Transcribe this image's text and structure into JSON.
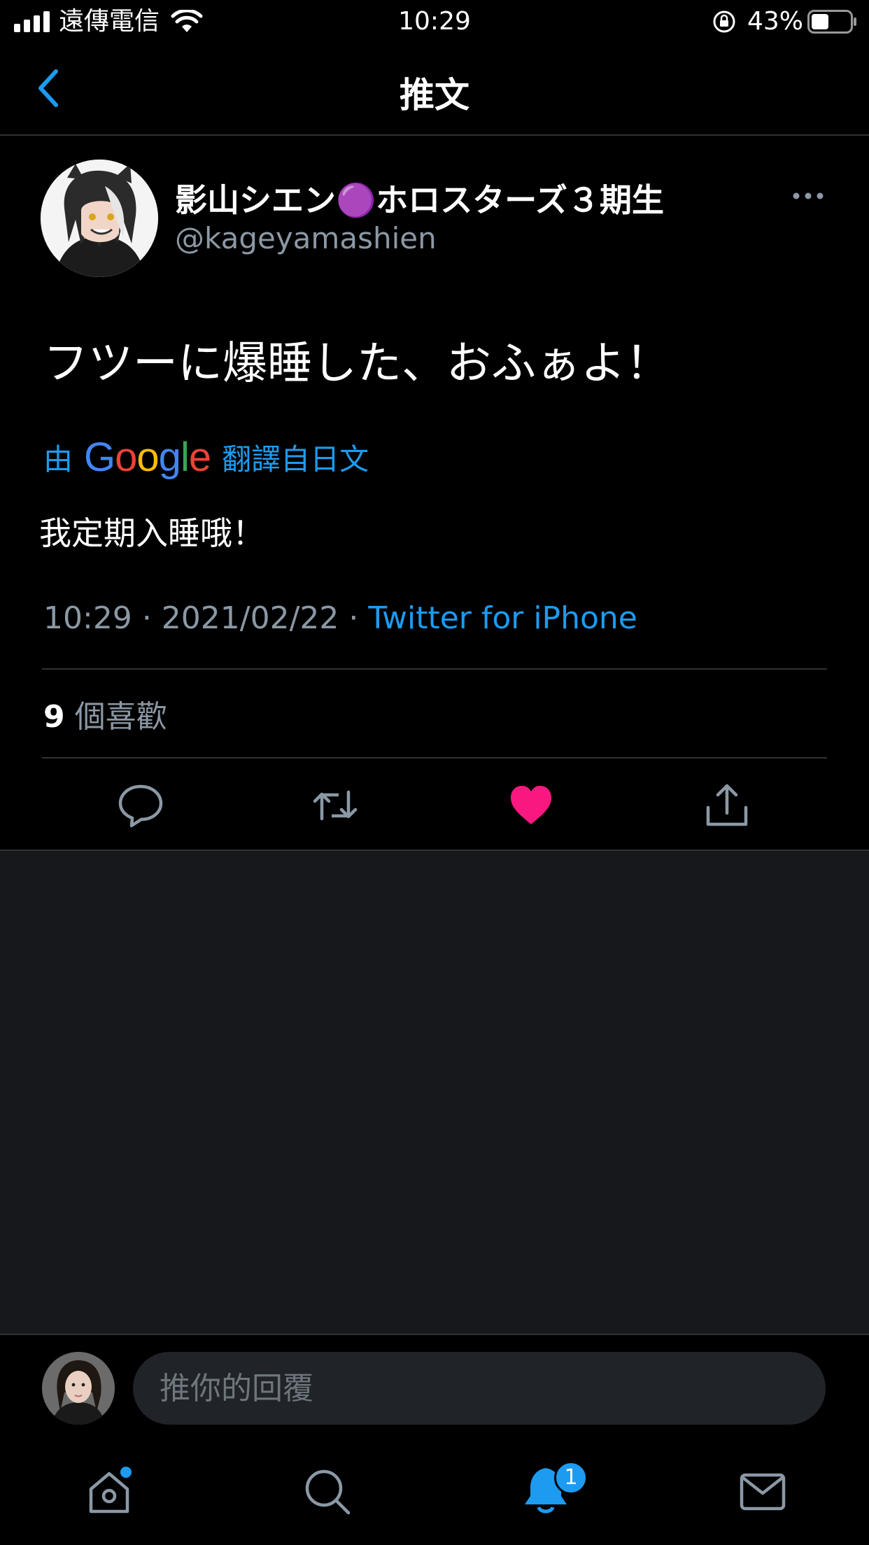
{
  "status_bar": {
    "carrier": "遠傳電信",
    "time": "10:29",
    "battery": "43%"
  },
  "nav": {
    "title": "推文",
    "back_icon": "chevron-left-icon"
  },
  "tweet": {
    "display_name": "影山シエン🟣ホロスターズ３期生",
    "handle": "@kageyamashien",
    "text": "フツーに爆睡した、おふぁよ！",
    "translate_prefix": "由",
    "translate_brand": "Google",
    "translate_suffix": "翻譯自日文",
    "translated_text": "我定期入睡哦！",
    "time": "10:29",
    "date": "2021/02/22",
    "source": "Twitter for iPhone",
    "likes_count": "9",
    "likes_label": "個喜歡",
    "liked": true
  },
  "reply": {
    "placeholder": "推你的回覆"
  },
  "tabbar": {
    "notification_badge": "1"
  },
  "colors": {
    "accent": "#1d9bf0",
    "like": "#f91880",
    "background": "#000000",
    "empty_area": "#16181c"
  }
}
